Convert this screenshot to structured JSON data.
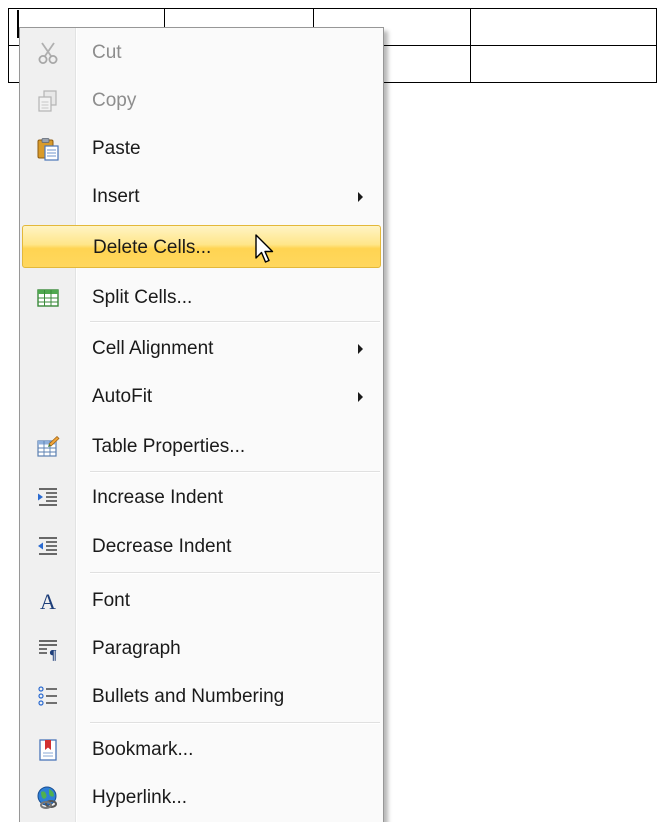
{
  "context_menu": {
    "items": [
      {
        "label": "Cut",
        "icon": "scissors-icon",
        "enabled": false,
        "submenu": false
      },
      {
        "label": "Copy",
        "icon": "copy-icon",
        "enabled": false,
        "submenu": false
      },
      {
        "label": "Paste",
        "icon": "clipboard-paste-icon",
        "enabled": true,
        "submenu": false
      },
      {
        "label": "Insert",
        "icon": null,
        "enabled": true,
        "submenu": true
      },
      {
        "label": "Delete Cells...",
        "icon": null,
        "enabled": true,
        "submenu": false,
        "highlighted": true
      },
      {
        "label": "Split Cells...",
        "icon": "table-grid-icon",
        "enabled": true,
        "submenu": false
      },
      {
        "label": "Cell Alignment",
        "icon": null,
        "enabled": true,
        "submenu": true
      },
      {
        "label": "AutoFit",
        "icon": null,
        "enabled": true,
        "submenu": true
      },
      {
        "label": "Table Properties...",
        "icon": "table-properties-icon",
        "enabled": true,
        "submenu": false
      },
      {
        "label": "Increase Indent",
        "icon": "increase-indent-icon",
        "enabled": true,
        "submenu": false
      },
      {
        "label": "Decrease Indent",
        "icon": "decrease-indent-icon",
        "enabled": true,
        "submenu": false
      },
      {
        "label": "Font",
        "icon": "font-icon",
        "enabled": true,
        "submenu": false
      },
      {
        "label": "Paragraph",
        "icon": "paragraph-icon",
        "enabled": true,
        "submenu": false
      },
      {
        "label": "Bullets and Numbering",
        "icon": "numbered-list-icon",
        "enabled": true,
        "submenu": false
      },
      {
        "label": "Bookmark...",
        "icon": "bookmark-icon",
        "enabled": true,
        "submenu": false
      },
      {
        "label": "Hyperlink...",
        "icon": "hyperlink-globe-icon",
        "enabled": true,
        "submenu": false
      }
    ]
  },
  "colors": {
    "highlight_top": "#fff4c4",
    "highlight_bottom": "#ffd452",
    "highlight_border": "#e3b83a",
    "disabled_text": "#8d8d8d",
    "gutter": "#f0f0f0"
  }
}
